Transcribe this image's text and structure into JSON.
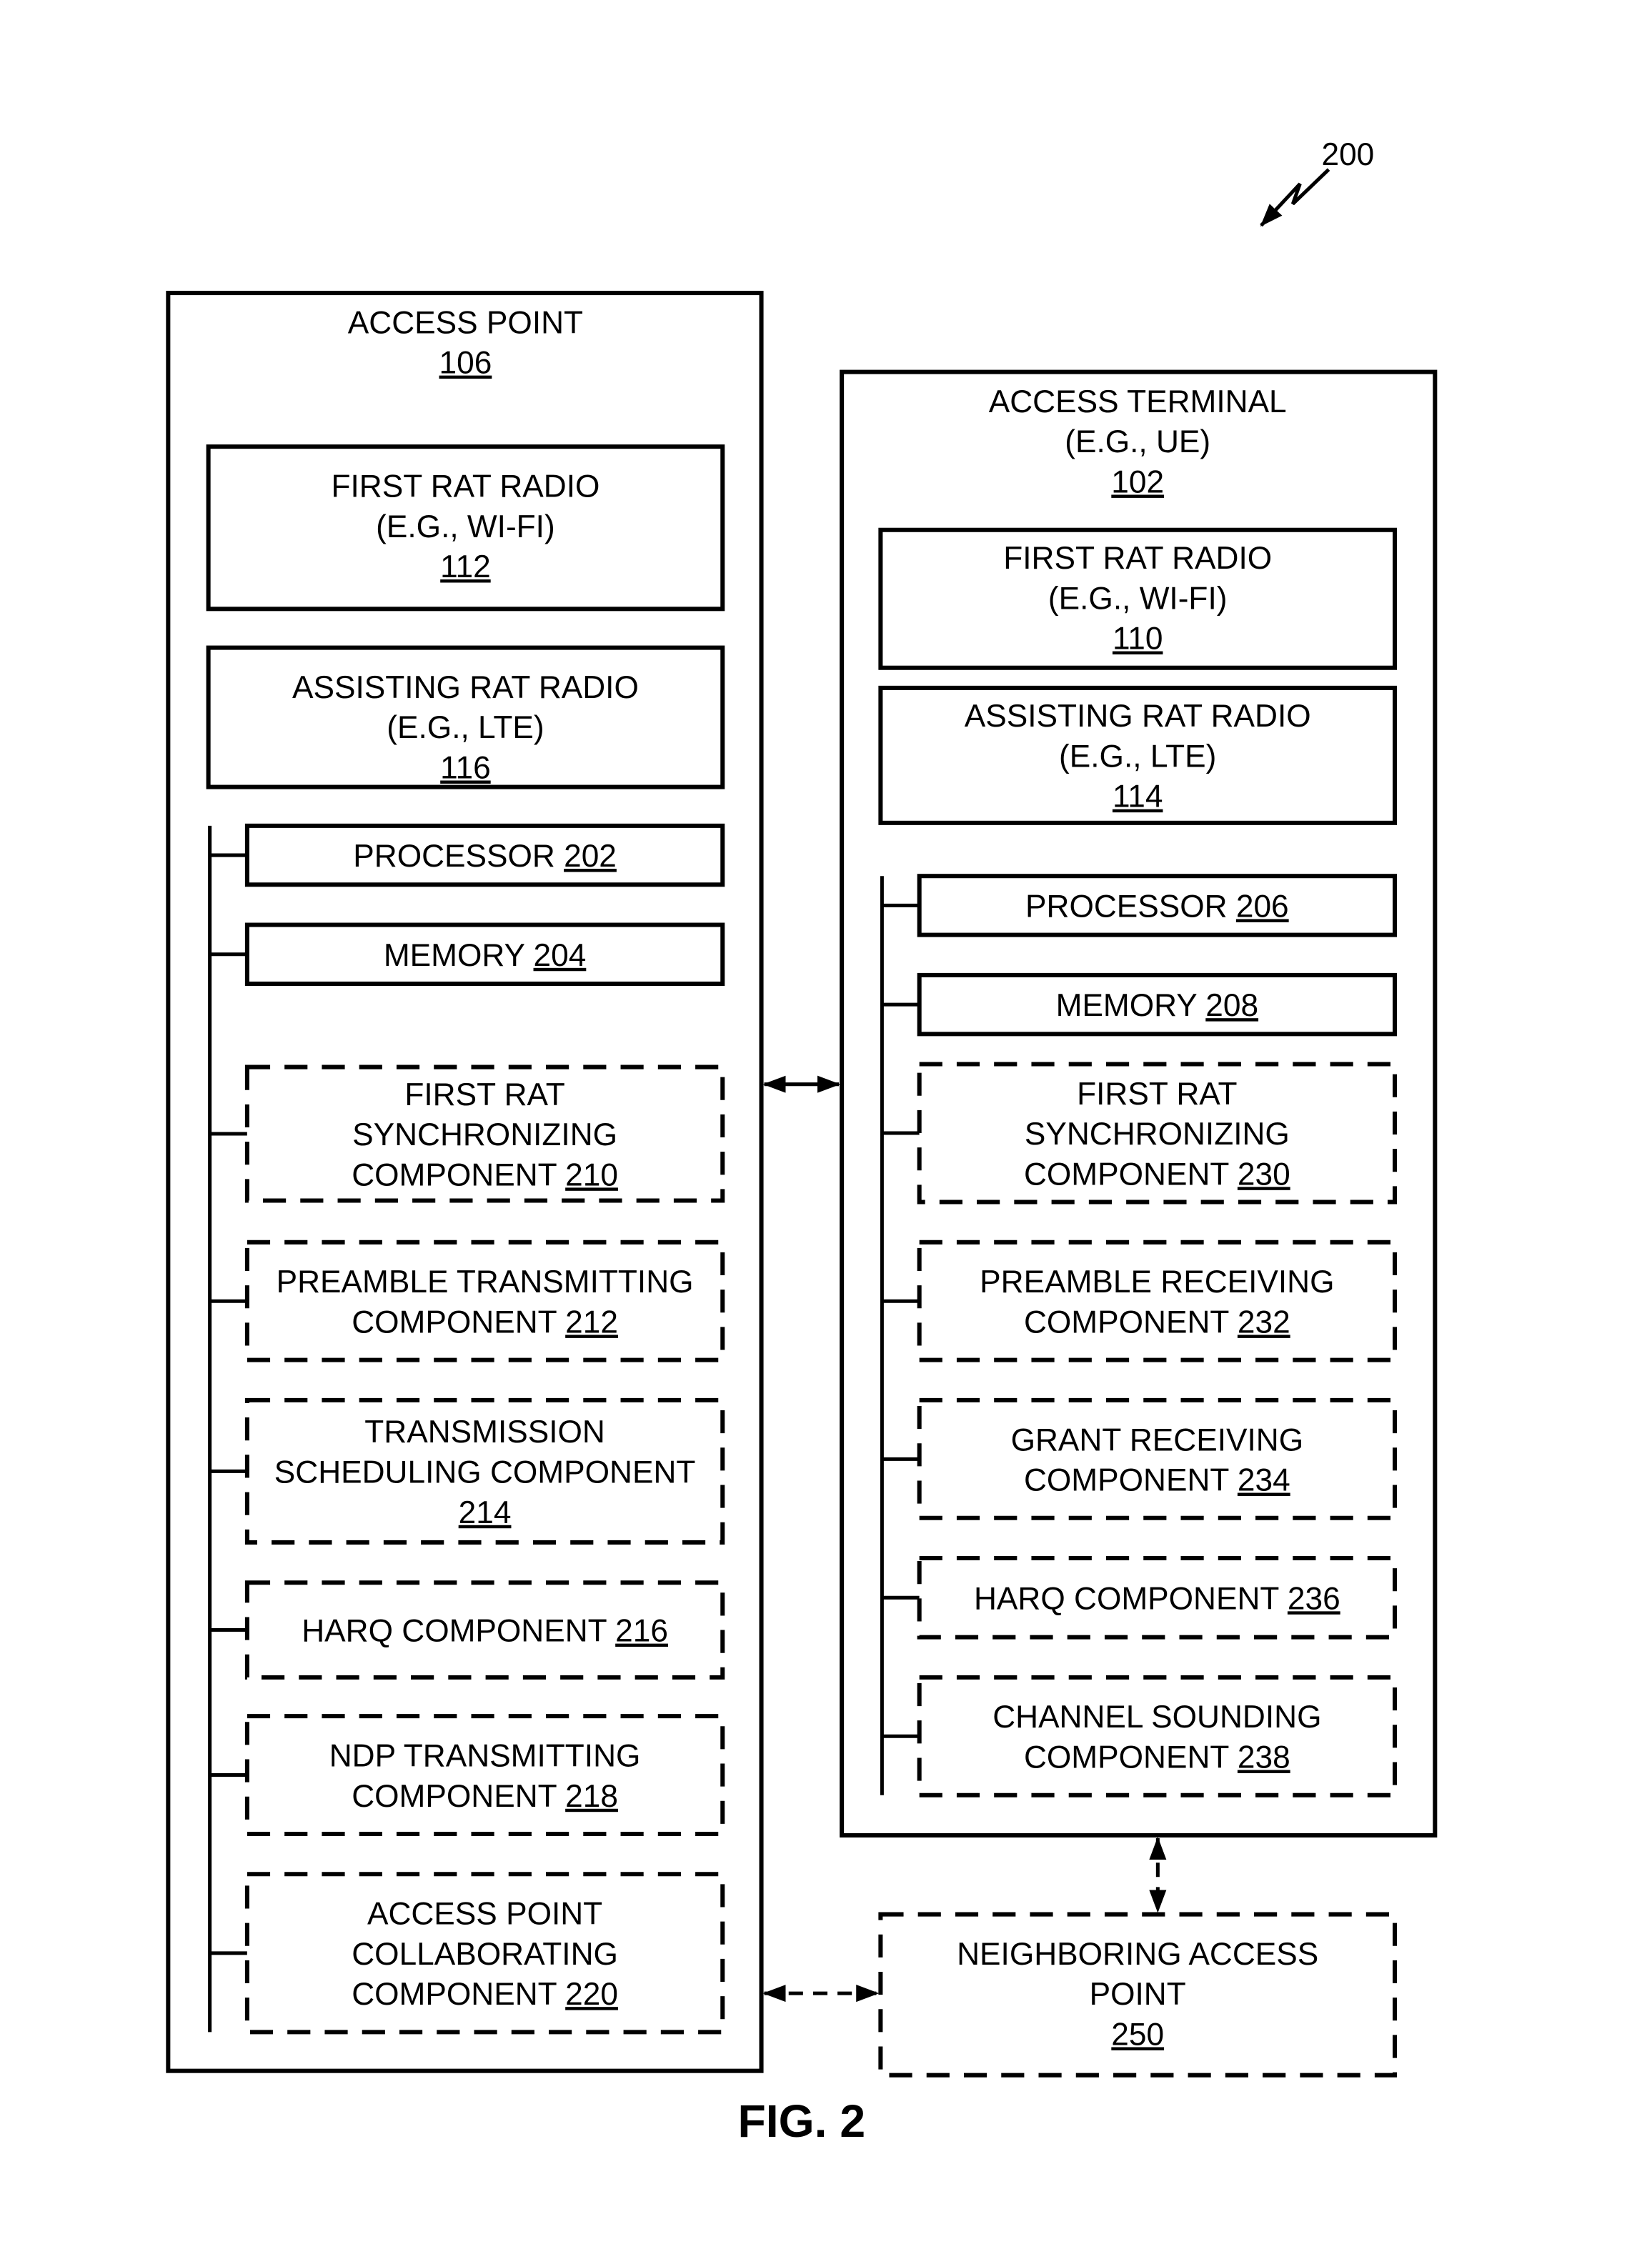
{
  "figure": {
    "ref": "200",
    "caption": "FIG. 2"
  },
  "access_point": {
    "title": "ACCESS POINT",
    "ref": "106",
    "radios": [
      {
        "lines": [
          "FIRST RAT RADIO",
          "(E.G., WI-FI)"
        ],
        "ref": "112"
      },
      {
        "lines": [
          "ASSISTING RAT RADIO",
          "(E.G., LTE)"
        ],
        "ref": "116"
      }
    ],
    "components": [
      {
        "lines": [
          "PROCESSOR"
        ],
        "ref": "202",
        "dashed": false
      },
      {
        "lines": [
          "MEMORY"
        ],
        "ref": "204",
        "dashed": false
      },
      {
        "lines": [
          "FIRST RAT",
          "SYNCHRONIZING",
          "COMPONENT"
        ],
        "ref": "210",
        "dashed": true
      },
      {
        "lines": [
          "PREAMBLE TRANSMITTING",
          "COMPONENT"
        ],
        "ref": "212",
        "dashed": true
      },
      {
        "lines": [
          "TRANSMISSION",
          "SCHEDULING COMPONENT"
        ],
        "ref": "214",
        "ref_own_line": true,
        "dashed": true
      },
      {
        "lines": [
          "HARQ COMPONENT"
        ],
        "ref": "216",
        "dashed": true
      },
      {
        "lines": [
          "NDP TRANSMITTING",
          "COMPONENT"
        ],
        "ref": "218",
        "dashed": true
      },
      {
        "lines": [
          "ACCESS POINT",
          "COLLABORATING",
          "COMPONENT"
        ],
        "ref": "220",
        "dashed": true
      }
    ]
  },
  "access_terminal": {
    "title": "ACCESS TERMINAL",
    "subtitle": "(E.G., UE)",
    "ref": "102",
    "radios": [
      {
        "lines": [
          "FIRST RAT RADIO",
          "(E.G., WI-FI)"
        ],
        "ref": "110"
      },
      {
        "lines": [
          "ASSISTING RAT RADIO",
          "(E.G., LTE)"
        ],
        "ref": "114"
      }
    ],
    "components": [
      {
        "lines": [
          "PROCESSOR"
        ],
        "ref": "206",
        "dashed": false
      },
      {
        "lines": [
          "MEMORY"
        ],
        "ref": "208",
        "dashed": false
      },
      {
        "lines": [
          "FIRST RAT",
          "SYNCHRONIZING",
          "COMPONENT"
        ],
        "ref": "230",
        "dashed": true
      },
      {
        "lines": [
          "PREAMBLE RECEIVING",
          "COMPONENT"
        ],
        "ref": "232",
        "dashed": true
      },
      {
        "lines": [
          "GRANT RECEIVING",
          "COMPONENT"
        ],
        "ref": "234",
        "dashed": true
      },
      {
        "lines": [
          "HARQ COMPONENT"
        ],
        "ref": "236",
        "dashed": true
      },
      {
        "lines": [
          "CHANNEL SOUNDING",
          "COMPONENT"
        ],
        "ref": "238",
        "dashed": true
      }
    ]
  },
  "neighboring_ap": {
    "lines": [
      "NEIGHBORING ACCESS",
      "POINT"
    ],
    "ref": "250"
  }
}
